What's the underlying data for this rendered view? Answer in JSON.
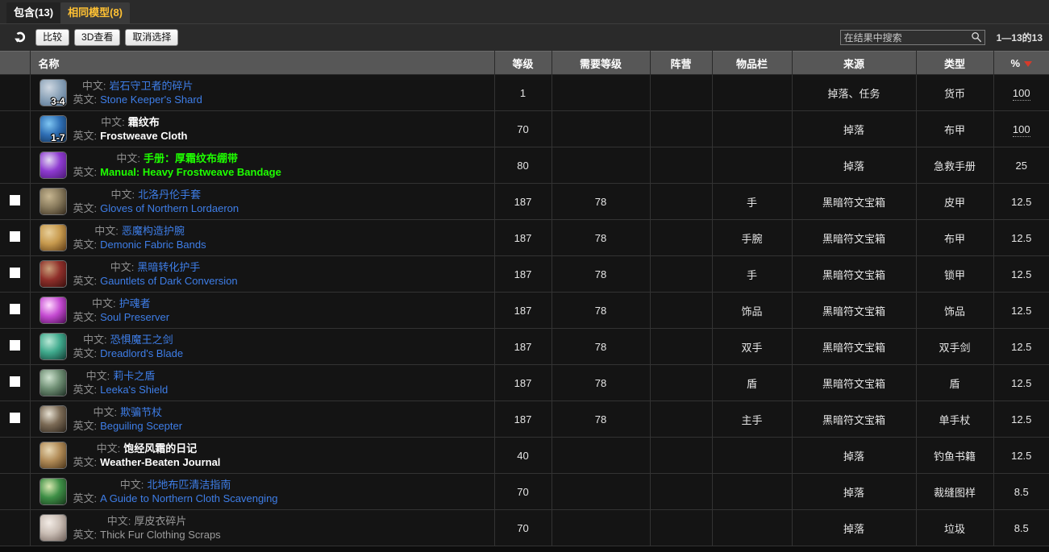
{
  "tabs": [
    {
      "label": "包含(13)",
      "active": true,
      "name": "tab-contains"
    },
    {
      "label": "相同模型(8)",
      "active": false,
      "name": "tab-same-model"
    }
  ],
  "toolbar": {
    "refresh_icon": "refresh-arrow-icon",
    "buttons": [
      {
        "label": "比较",
        "name": "compare-button"
      },
      {
        "label": "3D查看",
        "name": "view-3d-button"
      },
      {
        "label": "取消选择",
        "name": "deselect-button"
      }
    ],
    "search": {
      "placeholder": "在结果中搜索",
      "value": "",
      "icon": "search-icon"
    },
    "result_count": "1—13的13"
  },
  "table": {
    "columns": [
      {
        "key": "check",
        "label": "",
        "name": "column-checkbox"
      },
      {
        "key": "name",
        "label": "名称",
        "name": "column-name"
      },
      {
        "key": "level",
        "label": "等级",
        "name": "column-level"
      },
      {
        "key": "req",
        "label": "需要等级",
        "name": "column-required-level"
      },
      {
        "key": "faction",
        "label": "阵营",
        "name": "column-faction"
      },
      {
        "key": "slot",
        "label": "物品栏",
        "name": "column-slot"
      },
      {
        "key": "source",
        "label": "来源",
        "name": "column-source"
      },
      {
        "key": "type",
        "label": "类型",
        "name": "column-type"
      },
      {
        "key": "pct",
        "label": "%",
        "name": "column-percent",
        "sorted": "desc",
        "sort_color": "#d63b2b"
      }
    ],
    "label_cn": "中文:",
    "label_en": "英文:",
    "rows": [
      {
        "checkbox": false,
        "icon": {
          "name": "stone-keepers-shard-icon",
          "colors": [
            "#8fa6bb",
            "#4f6d8e",
            "#cfd8e2"
          ],
          "stack": "3-4"
        },
        "name_cn": "岩石守卫者的碎片",
        "name_en": "Stone Keeper's Shard",
        "quality": "rare",
        "level": "1",
        "req": "",
        "faction": "",
        "slot": "",
        "source": "掉落、任务",
        "type": "货币",
        "pct": "100",
        "pct_tip": true
      },
      {
        "checkbox": false,
        "icon": {
          "name": "frostweave-cloth-icon",
          "colors": [
            "#2f6fb5",
            "#0d2a4d",
            "#7fc6f2"
          ],
          "stack": "1-7"
        },
        "name_cn": "霜纹布",
        "name_en": "Frostweave Cloth",
        "quality": "common",
        "level": "70",
        "req": "",
        "faction": "",
        "slot": "",
        "source": "掉落",
        "type": "布甲",
        "pct": "100",
        "pct_tip": true
      },
      {
        "checkbox": false,
        "icon": {
          "name": "manual-heavy-frostweave-bandage-icon",
          "colors": [
            "#8e3bd0",
            "#4a1773",
            "#e3d9f2"
          ],
          "stack": ""
        },
        "name_cn": "手册：厚霜纹布绷带",
        "name_en": "Manual: Heavy Frostweave Bandage",
        "quality": "uncommon",
        "level": "80",
        "req": "",
        "faction": "",
        "slot": "",
        "source": "掉落",
        "type": "急救手册",
        "pct": "25",
        "pct_tip": false
      },
      {
        "checkbox": true,
        "icon": {
          "name": "gloves-of-northern-lordaeron-icon",
          "colors": [
            "#8a7c5e",
            "#33291c",
            "#c7b691"
          ],
          "stack": ""
        },
        "name_cn": "北洛丹伦手套",
        "name_en": "Gloves of Northern Lordaeron",
        "quality": "rare",
        "level": "187",
        "req": "78",
        "faction": "",
        "slot": "手",
        "source": "黑暗符文宝箱",
        "type": "皮甲",
        "pct": "12.5",
        "pct_tip": false
      },
      {
        "checkbox": true,
        "icon": {
          "name": "demonic-fabric-bands-icon",
          "colors": [
            "#c79a4e",
            "#5c3a15",
            "#e8cf9a"
          ],
          "stack": ""
        },
        "name_cn": "恶魔构造护腕",
        "name_en": "Demonic Fabric Bands",
        "quality": "rare",
        "level": "187",
        "req": "78",
        "faction": "",
        "slot": "手腕",
        "source": "黑暗符文宝箱",
        "type": "布甲",
        "pct": "12.5",
        "pct_tip": false
      },
      {
        "checkbox": true,
        "icon": {
          "name": "gauntlets-of-dark-conversion-icon",
          "colors": [
            "#8e2f2a",
            "#3a0f0d",
            "#c9a07a"
          ],
          "stack": ""
        },
        "name_cn": "黑暗转化护手",
        "name_en": "Gauntlets of Dark Conversion",
        "quality": "rare",
        "level": "187",
        "req": "78",
        "faction": "",
        "slot": "手",
        "source": "黑暗符文宝箱",
        "type": "锁甲",
        "pct": "12.5",
        "pct_tip": false
      },
      {
        "checkbox": true,
        "icon": {
          "name": "soul-preserver-icon",
          "colors": [
            "#c44ad1",
            "#4a0b52",
            "#ffd9ff"
          ],
          "stack": ""
        },
        "name_cn": "护魂者",
        "name_en": "Soul Preserver",
        "quality": "rare",
        "level": "187",
        "req": "78",
        "faction": "",
        "slot": "饰品",
        "source": "黑暗符文宝箱",
        "type": "饰品",
        "pct": "12.5",
        "pct_tip": false
      },
      {
        "checkbox": true,
        "icon": {
          "name": "dreadlords-blade-icon",
          "colors": [
            "#3fa98c",
            "#123b33",
            "#b9e8d6"
          ],
          "stack": ""
        },
        "name_cn": "恐惧魔王之剑",
        "name_en": "Dreadlord's Blade",
        "quality": "rare",
        "level": "187",
        "req": "78",
        "faction": "",
        "slot": "双手",
        "source": "黑暗符文宝箱",
        "type": "双手剑",
        "pct": "12.5",
        "pct_tip": false
      },
      {
        "checkbox": true,
        "icon": {
          "name": "leekas-shield-icon",
          "colors": [
            "#6f8f74",
            "#1d2e23",
            "#cfe3d0"
          ],
          "stack": ""
        },
        "name_cn": "莉卡之盾",
        "name_en": "Leeka's Shield",
        "quality": "rare",
        "level": "187",
        "req": "78",
        "faction": "",
        "slot": "盾",
        "source": "黑暗符文宝箱",
        "type": "盾",
        "pct": "12.5",
        "pct_tip": false
      },
      {
        "checkbox": true,
        "icon": {
          "name": "beguiling-scepter-icon",
          "colors": [
            "#7b6a55",
            "#2a2219",
            "#e6e0d2"
          ],
          "stack": ""
        },
        "name_cn": "欺骗节杖",
        "name_en": "Beguiling Scepter",
        "quality": "rare",
        "level": "187",
        "req": "78",
        "faction": "",
        "slot": "主手",
        "source": "黑暗符文宝箱",
        "type": "单手杖",
        "pct": "12.5",
        "pct_tip": false
      },
      {
        "checkbox": false,
        "icon": {
          "name": "weather-beaten-journal-icon",
          "colors": [
            "#b08a56",
            "#4a3419",
            "#e8d8b4"
          ],
          "stack": ""
        },
        "name_cn": "饱经风霜的日记",
        "name_en": "Weather-Beaten Journal",
        "quality": "common",
        "level": "40",
        "req": "",
        "faction": "",
        "slot": "",
        "source": "掉落",
        "type": "钓鱼书籍",
        "pct": "12.5",
        "pct_tip": false
      },
      {
        "checkbox": false,
        "icon": {
          "name": "guide-northern-cloth-scavenging-icon",
          "colors": [
            "#3e8f46",
            "#16361a",
            "#d8e8b0"
          ],
          "stack": ""
        },
        "name_cn": "北地布匹清洁指南",
        "name_en": "A Guide to Northern Cloth Scavenging",
        "quality": "rare",
        "level": "70",
        "req": "",
        "faction": "",
        "slot": "",
        "source": "掉落",
        "type": "裁缝图样",
        "pct": "8.5",
        "pct_tip": false
      },
      {
        "checkbox": false,
        "icon": {
          "name": "thick-fur-clothing-scraps-icon",
          "colors": [
            "#c9bdb4",
            "#6e5f58",
            "#f3ece6"
          ],
          "stack": ""
        },
        "name_cn": "厚皮衣碎片",
        "name_en": "Thick Fur Clothing Scraps",
        "quality": "poor",
        "level": "70",
        "req": "",
        "faction": "",
        "slot": "",
        "source": "掉落",
        "type": "垃圾",
        "pct": "8.5",
        "pct_tip": false
      }
    ]
  }
}
